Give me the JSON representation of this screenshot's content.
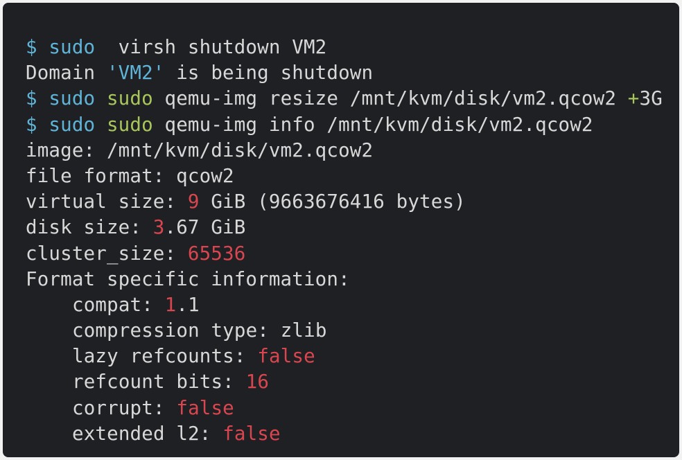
{
  "colors": {
    "background": "#1f2023",
    "text": "#d8d8d8",
    "prompt": "#5fb4d8",
    "command": "#a8c65b",
    "string": "#5fb4d8",
    "number": "#d9464f",
    "plus": "#a8c65b"
  },
  "lines": [
    {
      "name": "cmd-shutdown",
      "indent": false,
      "segments": [
        {
          "text": "$ ",
          "role": "prompt"
        },
        {
          "text": "sudo",
          "role": "prompt"
        },
        {
          "text": "  virsh shutdown VM2",
          "role": "text"
        }
      ]
    },
    {
      "name": "output-domain-shutdown",
      "indent": false,
      "segments": [
        {
          "text": "Domain ",
          "role": "text"
        },
        {
          "text": "'VM2'",
          "role": "string"
        },
        {
          "text": " is being shutdown",
          "role": "text"
        }
      ]
    },
    {
      "name": "cmd-resize",
      "indent": false,
      "segments": [
        {
          "text": "$ ",
          "role": "prompt"
        },
        {
          "text": "sudo",
          "role": "prompt"
        },
        {
          "text": " ",
          "role": "text"
        },
        {
          "text": "sudo",
          "role": "command"
        },
        {
          "text": " qemu-img resize /mnt/kvm/disk/vm2.qcow2 ",
          "role": "text"
        },
        {
          "text": "+",
          "role": "plus"
        },
        {
          "text": "3G",
          "role": "text"
        }
      ]
    },
    {
      "name": "cmd-info",
      "indent": false,
      "segments": [
        {
          "text": "$ ",
          "role": "prompt"
        },
        {
          "text": "sudo",
          "role": "prompt"
        },
        {
          "text": " ",
          "role": "text"
        },
        {
          "text": "sudo",
          "role": "command"
        },
        {
          "text": " qemu-img info /mnt/kvm/disk/vm2.qcow2",
          "role": "text"
        }
      ]
    },
    {
      "name": "output-image",
      "indent": false,
      "segments": [
        {
          "text": "image: /mnt/kvm/disk/vm2.qcow2",
          "role": "text"
        }
      ]
    },
    {
      "name": "output-file-format",
      "indent": false,
      "segments": [
        {
          "text": "file format: qcow2",
          "role": "text"
        }
      ]
    },
    {
      "name": "output-virtual-size",
      "indent": false,
      "segments": [
        {
          "text": "virtual size: ",
          "role": "text"
        },
        {
          "text": "9",
          "role": "number"
        },
        {
          "text": " GiB (9663676416 bytes)",
          "role": "text"
        }
      ]
    },
    {
      "name": "output-disk-size",
      "indent": false,
      "segments": [
        {
          "text": "disk size: ",
          "role": "text"
        },
        {
          "text": "3",
          "role": "number"
        },
        {
          "text": ".67 GiB",
          "role": "text"
        }
      ]
    },
    {
      "name": "output-cluster-size",
      "indent": false,
      "segments": [
        {
          "text": "cluster_size: ",
          "role": "text"
        },
        {
          "text": "65536",
          "role": "number"
        }
      ]
    },
    {
      "name": "output-format-specific",
      "indent": false,
      "segments": [
        {
          "text": "Format specific information:",
          "role": "text"
        }
      ]
    },
    {
      "name": "output-compat",
      "indent": true,
      "segments": [
        {
          "text": "compat: ",
          "role": "text"
        },
        {
          "text": "1",
          "role": "number"
        },
        {
          "text": ".1",
          "role": "text"
        }
      ]
    },
    {
      "name": "output-compression-type",
      "indent": true,
      "segments": [
        {
          "text": "compression type: zlib",
          "role": "text"
        }
      ]
    },
    {
      "name": "output-lazy-refcounts",
      "indent": true,
      "segments": [
        {
          "text": "lazy refcounts: ",
          "role": "text"
        },
        {
          "text": "false",
          "role": "number"
        }
      ]
    },
    {
      "name": "output-refcount-bits",
      "indent": true,
      "segments": [
        {
          "text": "refcount bits: ",
          "role": "text"
        },
        {
          "text": "16",
          "role": "number"
        }
      ]
    },
    {
      "name": "output-corrupt",
      "indent": true,
      "segments": [
        {
          "text": "corrupt: ",
          "role": "text"
        },
        {
          "text": "false",
          "role": "number"
        }
      ]
    },
    {
      "name": "output-extended-l2",
      "indent": true,
      "segments": [
        {
          "text": "extended l2: ",
          "role": "text"
        },
        {
          "text": "false",
          "role": "number"
        }
      ]
    }
  ]
}
